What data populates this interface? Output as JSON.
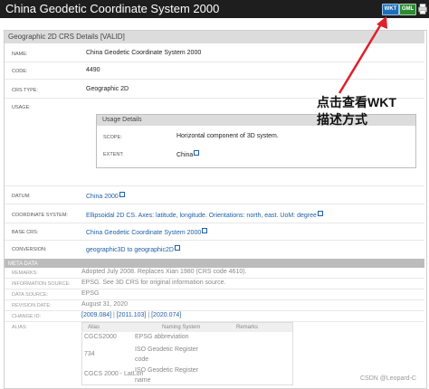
{
  "header": {
    "title": "China Geodetic Coordinate System 2000",
    "wkt_label": "WKT",
    "gml_label": "GML",
    "print_icon": "print-icon"
  },
  "details": {
    "section_title": "Geographic 2D CRS Details [VALID]",
    "rows": [
      {
        "label": "NAME:",
        "value": "China Geodetic Coordinate System 2000"
      },
      {
        "label": "CODE:",
        "value": "4490"
      },
      {
        "label": "CRS TYPE:",
        "value": "Geographic 2D"
      },
      {
        "label": "USAGE:",
        "value": ""
      }
    ],
    "usage": {
      "title": "Usage Details",
      "scope_label": "SCOPE:",
      "scope_value": "Horizontal component of 3D system.",
      "extent_label": "EXTENT:",
      "extent_value": "China"
    },
    "links": [
      {
        "label": "DATUM:",
        "value": "China 2000"
      },
      {
        "label": "COORDINATE SYSTEM:",
        "value": "Ellipsoidal 2D CS. Axes: latitude, longitude. Orientations: north, east. UoM: degree"
      },
      {
        "label": "BASE CRS:",
        "value": "China Geodetic Coordinate System 2000"
      },
      {
        "label": "CONVERSION:",
        "value": "geographic3D to geographic2D"
      }
    ]
  },
  "meta": {
    "section_title": "META DATA",
    "rows": [
      {
        "label": "REMARKS:",
        "value": "Adopted July 2008. Replaces Xian 1980 (CRS code 4610)."
      },
      {
        "label": "INFORMATION SOURCE:",
        "value": "EPSG. See 3D CRS for original information source."
      },
      {
        "label": "DATA SOURCE:",
        "value": "EPSG"
      },
      {
        "label": "REVISION DATE:",
        "value": "August 31, 2020"
      },
      {
        "label": "CHANGE ID:",
        "value": ""
      },
      {
        "label": "ALIAS:",
        "value": ""
      }
    ],
    "change_ids": [
      "[2009.084]",
      "[2011.103]",
      "[2020.074]"
    ],
    "alias_table": {
      "headers": [
        "Alias",
        "Naming System",
        "Remarks"
      ],
      "rows": [
        [
          "CGCS2000",
          "EPSG abbreviation",
          ""
        ],
        [
          "734",
          "ISO Geodetic Register code",
          ""
        ],
        [
          "CGCS 2000 - LatLon",
          "ISO Geodetic Register name",
          ""
        ]
      ]
    }
  },
  "annotation": {
    "line1": "点击查看WKT",
    "line2": "描述方式",
    "color": "#e0202a"
  },
  "watermark": "CSDN @Leopard-C"
}
